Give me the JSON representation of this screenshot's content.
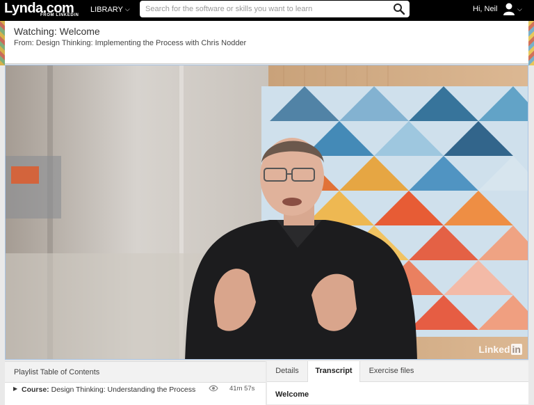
{
  "nav": {
    "logo_text": "Lynda.com",
    "logo_sub": "FROM LINKEDIN",
    "library_label": "LIBRARY",
    "search_placeholder": "Search for the software or skills you want to learn",
    "greeting": "Hi, Neil"
  },
  "watching": {
    "title": "Watching: Welcome",
    "from": "From: Design Thinking: Implementing the Process with Chris Nodder"
  },
  "video": {
    "watermark": "Linked",
    "watermark_in": "in"
  },
  "toc": {
    "header": "Playlist Table of Contents",
    "course_label": "Course:",
    "course_title": "Design Thinking: Understanding the Process",
    "duration": "41m 57s"
  },
  "tabs": {
    "items": [
      "Details",
      "Transcript",
      "Exercise files"
    ],
    "active": "Transcript"
  },
  "transcript": {
    "first_heading": "Welcome"
  },
  "colors": {
    "topbar": "#000000",
    "video_border": "#a9c4e4"
  }
}
